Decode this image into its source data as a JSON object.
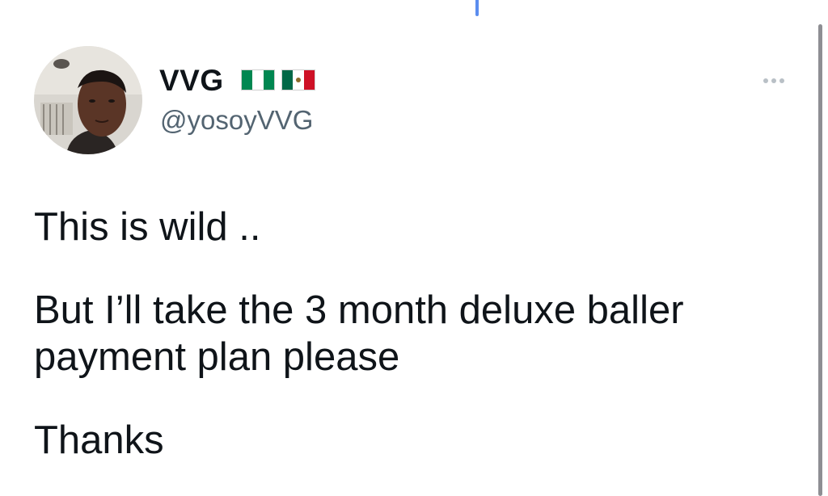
{
  "tweet": {
    "author": {
      "display_name": "VVG",
      "handle": "@yosoyVVG",
      "flags": [
        "nigeria-flag",
        "mexico-flag"
      ]
    },
    "menu_icon": "more-horizontal-icon",
    "paragraphs": [
      "This is wild ..",
      "But I’ll take the 3 month deluxe baller payment plan please",
      "Thanks"
    ]
  },
  "colors": {
    "text_primary": "#0f1419",
    "text_secondary": "#536471",
    "nigeria_green": "#008751",
    "mexico_green": "#006847",
    "mexico_red": "#ce1126"
  }
}
